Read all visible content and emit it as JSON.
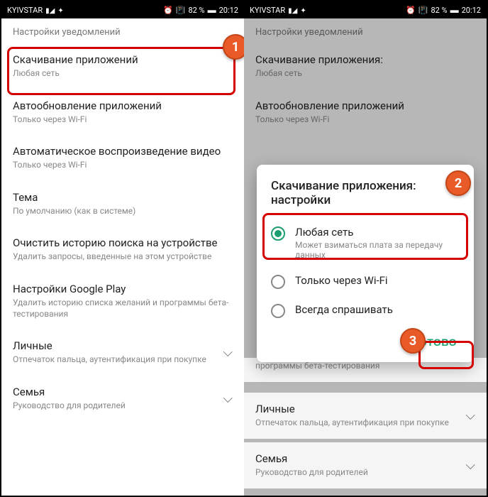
{
  "status": {
    "carrier": "KYIVSTAR",
    "battery": "82 %",
    "time": "20:12"
  },
  "left": {
    "header": "Настройки уведомлений",
    "items": [
      {
        "title": "Скачивание приложений",
        "subtitle": "Любая сеть"
      },
      {
        "title": "Автообновление приложений",
        "subtitle": "Только через Wi-Fi"
      },
      {
        "title": "Автоматическое воспроизведение видео",
        "subtitle": "Только через Wi-Fi"
      },
      {
        "title": "Тема",
        "subtitle": "По умолчанию (как в системе)"
      },
      {
        "title": "Очистить историю поиска на устройстве",
        "subtitle": "Удалить запросы, введенные на этом устройстве"
      },
      {
        "title": "Настройки Google Play",
        "subtitle": "Удалить историю списка желаний и программы бета-тестирования"
      },
      {
        "title": "Личные",
        "subtitle": "Отпечаток пальца, аутентификация при покупке"
      },
      {
        "title": "Семья",
        "subtitle": "Руководство для родителей"
      }
    ]
  },
  "right": {
    "header": "Настройки уведомлений",
    "item_download": {
      "title": "Скачивание приложения:",
      "subtitle": "Любая сеть"
    },
    "item_autoupdate": {
      "title": "Автообновление приложений",
      "subtitle": "Только через Wi-Fi"
    },
    "item_personal": {
      "title": "Личные",
      "subtitle": "Отпечаток пальца, аутентификация при покупке"
    },
    "item_family": {
      "title": "Семья",
      "subtitle": "Руководство для родителей"
    },
    "item_beta_stub": "программы бета-тестирования"
  },
  "dialog": {
    "title": "Скачивание приложения: настройки",
    "options": [
      {
        "label": "Любая сеть",
        "sublabel": "Может взиматься плата за передачу данных",
        "selected": true
      },
      {
        "label": "Только через Wi-Fi",
        "selected": false
      },
      {
        "label": "Всегда спрашивать",
        "selected": false
      }
    ],
    "done": "ГОТОВО"
  },
  "badges": {
    "1": "1",
    "2": "2",
    "3": "3"
  }
}
